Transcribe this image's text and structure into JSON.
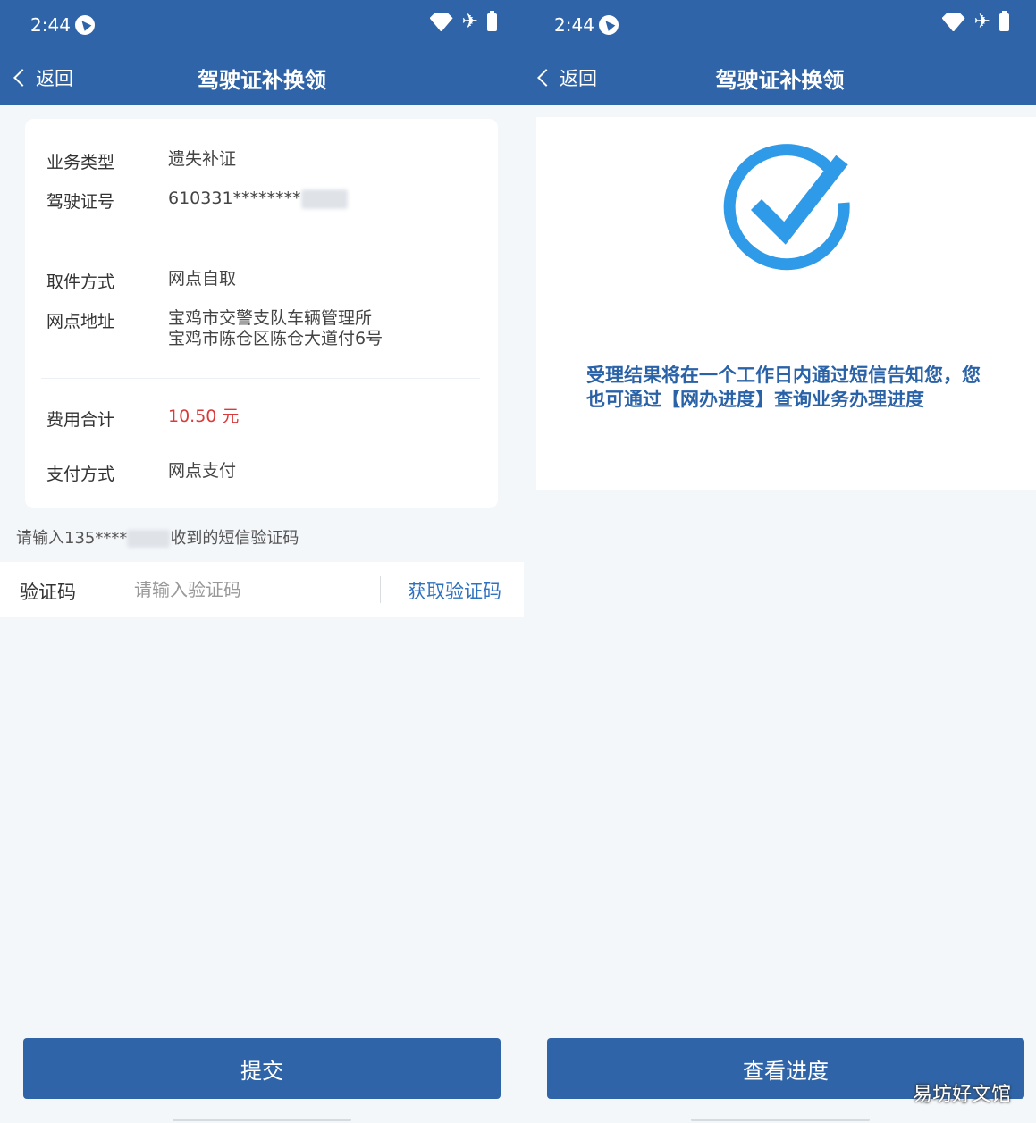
{
  "left": {
    "status": {
      "time": "2:44"
    },
    "nav": {
      "back_label": "返回",
      "title": "驾驶证补换领"
    },
    "card": {
      "business_type_label": "业务类型",
      "business_type_value": "遗失补证",
      "license_no_label": "驾驶证号",
      "license_no_value": "610331********",
      "pickup_label": "取件方式",
      "pickup_value": "网点自取",
      "address_label": "网点地址",
      "address_line1": "宝鸡市交警支队车辆管理所",
      "address_line2": "宝鸡市陈仓区陈仓大道付6号",
      "fee_label": "费用合计",
      "fee_value": "10.50 元",
      "payment_label": "支付方式",
      "payment_value": "网点支付"
    },
    "sms_hint_prefix": "请输入135****",
    "sms_hint_suffix": "收到的短信验证码",
    "code": {
      "label": "验证码",
      "placeholder": "请输入验证码",
      "get_code": "获取验证码"
    },
    "submit_label": "提交"
  },
  "right": {
    "status": {
      "time": "2:44"
    },
    "nav": {
      "back_label": "返回",
      "title": "驾驶证补换领"
    },
    "result_text": "受理结果将在一个工作日内通过短信告知您，您也可通过【网办进度】查询业务办理进度",
    "progress_label": "查看进度",
    "watermark": "易坊好文馆"
  },
  "colors": {
    "primary": "#2f65a8",
    "accent_blue": "#2f72bf",
    "fee_red": "#d93a3a",
    "check_blue": "#2f9ae8"
  },
  "icons": {
    "back": "chevron-left-icon",
    "success": "check-circle-icon",
    "wifi": "wifi-icon",
    "airplane": "airplane-icon",
    "battery": "battery-icon",
    "location": "location-arrow-icon"
  }
}
